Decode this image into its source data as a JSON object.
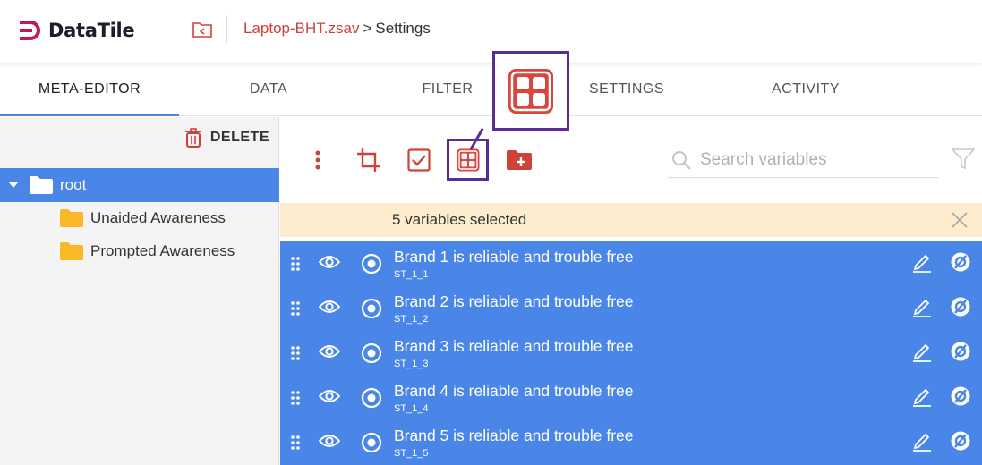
{
  "app": {
    "logo_text": "DataTile",
    "brand_color": "#d0413a",
    "accent_color": "#4a86e8",
    "highlight_color": "#5c2d91"
  },
  "breadcrumb": {
    "file": "Laptop-BHT.zsav",
    "separator": ">",
    "current": "Settings"
  },
  "tabs": [
    {
      "label": "META-EDITOR",
      "active": true
    },
    {
      "label": "DATA",
      "active": false
    },
    {
      "label": "FILTER",
      "active": false
    },
    {
      "label": "SETTINGS",
      "active": false
    },
    {
      "label": "ACTIVITY",
      "active": false
    }
  ],
  "left_panel": {
    "delete_label": "DELETE",
    "tree": {
      "root_label": "root",
      "children": [
        "Unaided Awareness",
        "Prompted Awareness"
      ]
    }
  },
  "toolbar": {
    "icons": [
      "more-vert-icon",
      "crop-icon",
      "checkbox-icon",
      "grid-icon",
      "new-folder-icon"
    ],
    "search_placeholder": "Search variables"
  },
  "selection": {
    "banner_text": "5 variables selected"
  },
  "variables": [
    {
      "title": "Brand 1 is reliable and trouble free",
      "code": "ST_1_1"
    },
    {
      "title": "Brand 2 is reliable and trouble free",
      "code": "ST_1_2"
    },
    {
      "title": "Brand 3 is reliable and trouble free",
      "code": "ST_1_3"
    },
    {
      "title": "Brand 4 is reliable and trouble free",
      "code": "ST_1_4"
    },
    {
      "title": "Brand 5 is reliable and trouble free",
      "code": "ST_1_5"
    }
  ]
}
